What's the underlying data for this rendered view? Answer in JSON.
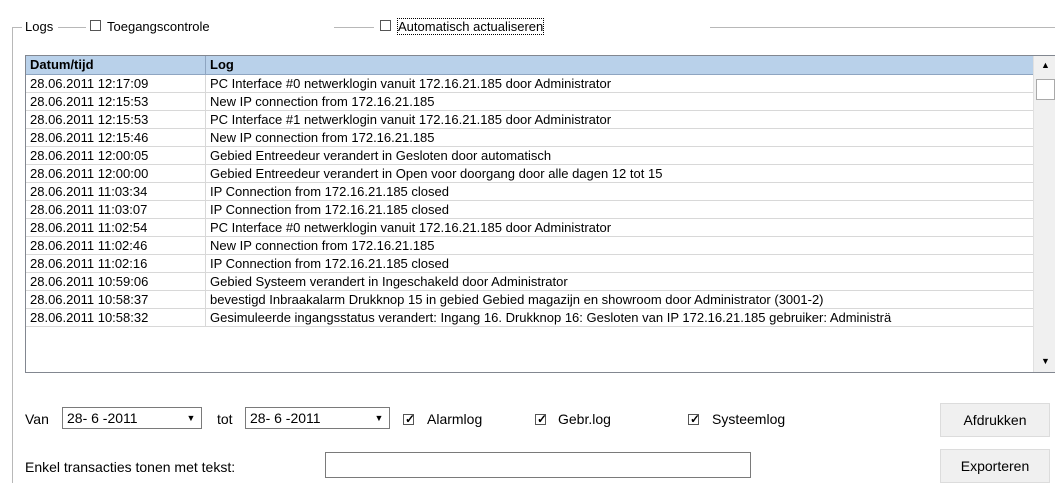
{
  "groupbox": {
    "title": "Logs",
    "toegang_label": "Toegangscontrole",
    "toegang_checked": false,
    "auto_label": "Automatisch actualiseren",
    "auto_checked": false
  },
  "table": {
    "columns": [
      "Datum/tijd",
      "Log"
    ],
    "rows": [
      [
        "28.06.2011 12:17:09",
        "PC Interface #0 netwerklogin vanuit 172.16.21.185 door Administrator"
      ],
      [
        "28.06.2011 12:15:53",
        "New IP connection from 172.16.21.185"
      ],
      [
        "28.06.2011 12:15:53",
        "PC Interface #1 netwerklogin vanuit 172.16.21.185 door Administrator"
      ],
      [
        "28.06.2011 12:15:46",
        "New IP connection from 172.16.21.185"
      ],
      [
        "28.06.2011 12:00:05",
        "Gebied Entreedeur verandert in Gesloten door automatisch"
      ],
      [
        "28.06.2011 12:00:00",
        "Gebied Entreedeur verandert in Open voor doorgang door alle dagen 12 tot 15"
      ],
      [
        "28.06.2011 11:03:34",
        "IP Connection from 172.16.21.185 closed"
      ],
      [
        "28.06.2011 11:03:07",
        "IP Connection from 172.16.21.185 closed"
      ],
      [
        "28.06.2011 11:02:54",
        "PC Interface #0 netwerklogin vanuit 172.16.21.185 door Administrator"
      ],
      [
        "28.06.2011 11:02:46",
        "New IP connection from 172.16.21.185"
      ],
      [
        "28.06.2011 11:02:16",
        "IP Connection from 172.16.21.185 closed"
      ],
      [
        "28.06.2011 10:59:06",
        "Gebied Systeem verandert in Ingeschakeld door Administrator"
      ],
      [
        "28.06.2011 10:58:37",
        "bevestigd Inbraakalarm Drukknop 15 in gebied Gebied magazijn en showroom door Administrator (3001-2)"
      ],
      [
        "28.06.2011 10:58:32",
        "Gesimuleerde ingangsstatus verandert: Ingang 16. Drukknop 16: Gesloten van IP 172.16.21.185 gebruiker: Administrä"
      ]
    ]
  },
  "filters": {
    "van_label": "Van",
    "van_value": "28- 6 -2011",
    "tot_label": "tot",
    "tot_value": "28- 6 -2011",
    "alarmlog_label": "Alarmlog",
    "alarmlog_checked": true,
    "gebrlog_label": "Gebr.log",
    "gebrlog_checked": true,
    "systeemlog_label": "Systeemlog",
    "systeemlog_checked": true,
    "text_filter_label": "Enkel transacties tonen met tekst:",
    "text_filter_value": ""
  },
  "buttons": {
    "print": "Afdrukken",
    "export": "Exporteren"
  }
}
